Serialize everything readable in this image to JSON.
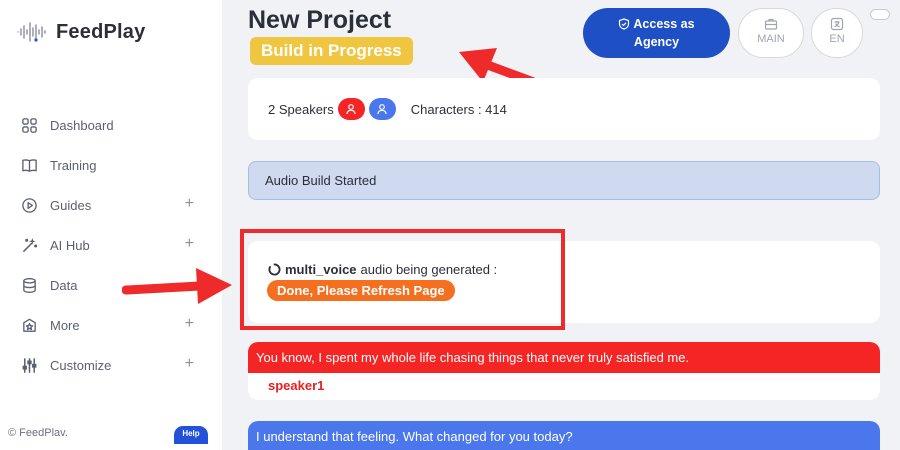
{
  "app": {
    "name": "FeedPlay"
  },
  "sidebar": {
    "items": [
      {
        "label": "Dashboard",
        "icon": "grid-icon",
        "expandable": false
      },
      {
        "label": "Training",
        "icon": "book-icon",
        "expandable": false
      },
      {
        "label": "Guides",
        "icon": "play-circle-icon",
        "expandable": true
      },
      {
        "label": "AI Hub",
        "icon": "magic-wand-icon",
        "expandable": true
      },
      {
        "label": "Data",
        "icon": "database-icon",
        "expandable": false
      },
      {
        "label": "More",
        "icon": "star-box-icon",
        "expandable": true
      },
      {
        "label": "Customize",
        "icon": "sliders-icon",
        "expandable": true
      }
    ],
    "plus_symbol": "+",
    "footer": {
      "copyright": "© FeedPlav.",
      "help_label": "Help"
    }
  },
  "header": {
    "title": "New Project",
    "status_badge": "Build in Progress",
    "agency_button": {
      "line1": "Access as",
      "line2": "Agency"
    },
    "main_button": "MAIN",
    "lang_button": "EN"
  },
  "speakers": {
    "count_label": "2 Speakers",
    "characters_label": "Characters : 414",
    "badge_colors": [
      "#f52525",
      "#4a78ec"
    ]
  },
  "status_bar": {
    "text": "Audio Build Started"
  },
  "generation": {
    "voice_name": "multi_voice",
    "suffix": "audio being generated :",
    "done_label": "Done, Please Refresh Page"
  },
  "dialogue": [
    {
      "text": "You know, I spent my whole life chasing things that never truly satisfied me.",
      "speaker": "speaker1",
      "color": "#f52525"
    },
    {
      "text": "I understand that feeling. What changed for you today?",
      "speaker": "",
      "color": "#4a78ec"
    }
  ],
  "colors": {
    "accent": "#1f4fc4",
    "badge": "#f0c53f",
    "annotation": "#ef2a2a",
    "done": "#f46f1f"
  }
}
